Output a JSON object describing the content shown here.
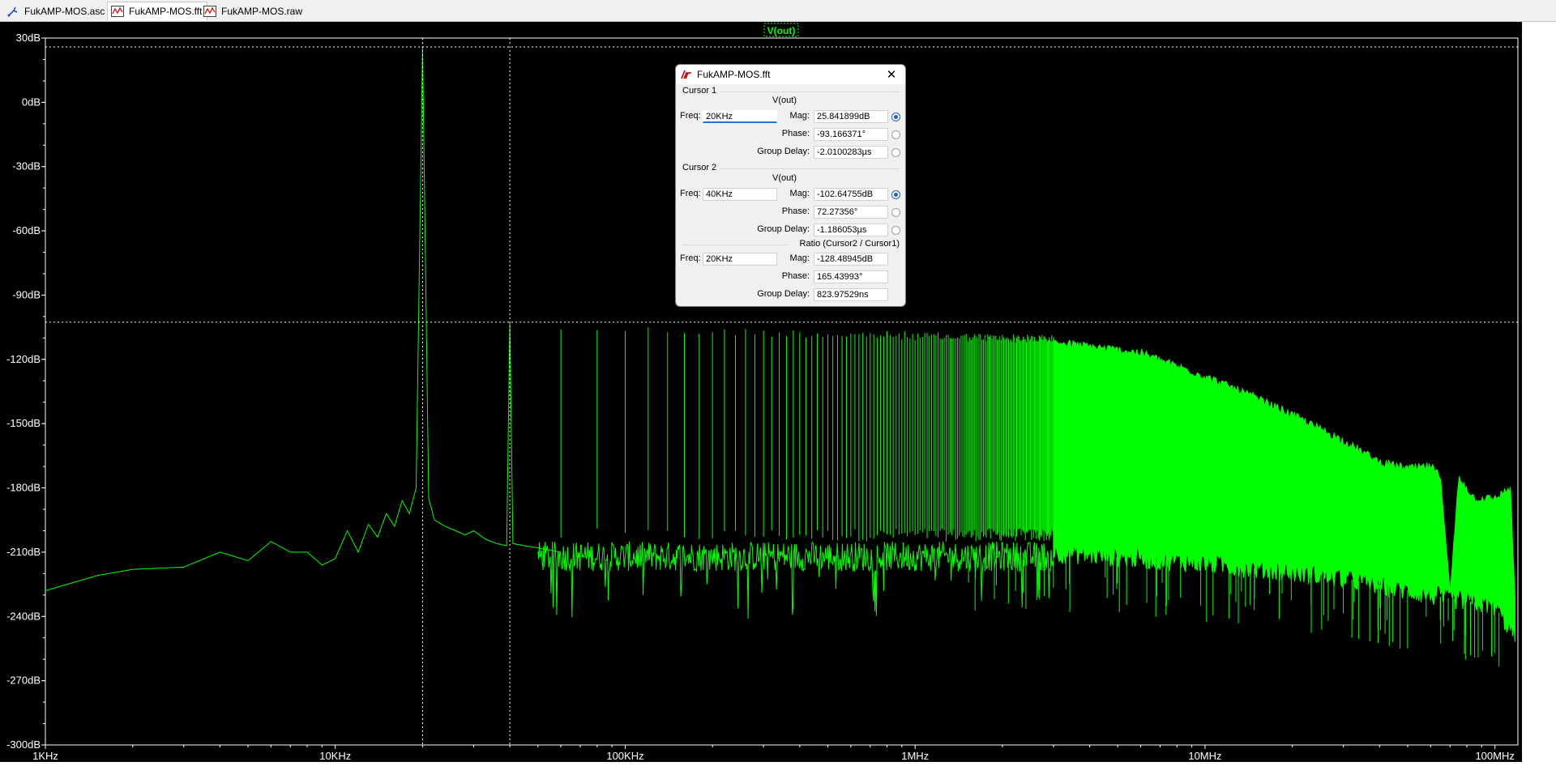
{
  "tabs": [
    {
      "label": "FukAMP-MOS.asc",
      "icon": "schematic-icon",
      "active": false
    },
    {
      "label": "FukAMP-MOS.fft",
      "icon": "waveform-icon",
      "active": true
    },
    {
      "label": "FukAMP-MOS.raw",
      "icon": "waveform-icon",
      "active": false
    }
  ],
  "trace_label": "V(out)",
  "colors": {
    "trace": "#00ff00",
    "background": "#000000",
    "axis": "#ffffff",
    "cursor": "#ffffff"
  },
  "chart_data": {
    "type": "line",
    "x_scale": "log",
    "xlim": [
      1000,
      120000000
    ],
    "ylim": [
      -300,
      30
    ],
    "x_ticks": [
      "1KHz",
      "10KHz",
      "100KHz",
      "1MHz",
      "10MHz",
      "100MHz"
    ],
    "x_tick_values": [
      1000,
      10000,
      100000,
      1000000,
      10000000,
      100000000
    ],
    "y_ticks": [
      "30dB",
      "0dB",
      "-30dB",
      "-60dB",
      "-90dB",
      "-120dB",
      "-150dB",
      "-180dB",
      "-210dB",
      "-240dB",
      "-270dB",
      "-300dB"
    ],
    "y_tick_values": [
      30,
      0,
      -30,
      -60,
      -90,
      -120,
      -150,
      -180,
      -210,
      -240,
      -270,
      -300
    ],
    "series": [
      {
        "name": "V(out)",
        "color": "#00ff00"
      }
    ],
    "floor_curve": [
      [
        1000,
        -228
      ],
      [
        1500,
        -221
      ],
      [
        2000,
        -218
      ],
      [
        3000,
        -217
      ],
      [
        4000,
        -210
      ],
      [
        5000,
        -214
      ],
      [
        6000,
        -205
      ],
      [
        7000,
        -210
      ],
      [
        8000,
        -210
      ],
      [
        9000,
        -216
      ],
      [
        10000,
        -213
      ],
      [
        11000,
        -200
      ],
      [
        12000,
        -210
      ],
      [
        13000,
        -197
      ],
      [
        14000,
        -203
      ],
      [
        15000,
        -192
      ],
      [
        16000,
        -198
      ],
      [
        17000,
        -186
      ],
      [
        18000,
        -192
      ],
      [
        19000,
        -180
      ],
      [
        20000,
        25.84
      ],
      [
        21000,
        -185
      ],
      [
        22000,
        -195
      ],
      [
        24000,
        -198
      ],
      [
        26000,
        -200
      ],
      [
        28000,
        -202
      ],
      [
        30000,
        -200
      ],
      [
        33000,
        -204
      ],
      [
        36000,
        -206
      ],
      [
        39000,
        -207
      ],
      [
        40000,
        -102.6
      ],
      [
        41000,
        -206
      ],
      [
        45000,
        -207
      ],
      [
        50000,
        -208
      ],
      [
        60000,
        -210
      ],
      [
        100000,
        -210
      ],
      [
        300000,
        -212
      ],
      [
        1000000,
        -212
      ],
      [
        3000000,
        -208
      ],
      [
        10000000,
        -205
      ],
      [
        30000000,
        -208
      ],
      [
        60000000,
        -215
      ],
      [
        70000000,
        -230
      ],
      [
        75000000,
        -175
      ],
      [
        85000000,
        -185
      ],
      [
        100000000,
        -185
      ],
      [
        113000000,
        -180
      ],
      [
        118000000,
        -240
      ]
    ],
    "envelope_top": [
      [
        3000000,
        -112
      ],
      [
        4000000,
        -114
      ],
      [
        6000000,
        -117
      ],
      [
        10000000,
        -128
      ],
      [
        15000000,
        -138
      ],
      [
        20000000,
        -146
      ],
      [
        30000000,
        -158
      ],
      [
        40000000,
        -168
      ],
      [
        50000000,
        -171
      ],
      [
        60000000,
        -170
      ],
      [
        65000000,
        -175
      ],
      [
        70000000,
        -230
      ],
      [
        75000000,
        -175
      ],
      [
        85000000,
        -185
      ],
      [
        100000000,
        -185
      ],
      [
        113000000,
        -180
      ],
      [
        118000000,
        -240
      ]
    ],
    "envelope_bottom": [
      [
        3000000,
        -210
      ],
      [
        10000000,
        -215
      ],
      [
        30000000,
        -222
      ],
      [
        60000000,
        -230
      ],
      [
        100000000,
        -235
      ],
      [
        118000000,
        -250
      ]
    ],
    "harmonics": {
      "fundamental": 20000,
      "count": 175,
      "peak_level": -102,
      "floor_level": -205
    },
    "cursor1": {
      "freq": 20000,
      "level": 25.841899
    },
    "cursor2": {
      "freq": 40000,
      "level": -102.64755
    }
  },
  "dialog": {
    "title": "FukAMP-MOS.fft",
    "cursor1": {
      "section": "Cursor 1",
      "trace": "V(out)",
      "freq_label": "Freq:",
      "freq": "20KHz",
      "mag_label": "Mag:",
      "mag": "25.841899dB",
      "phase_label": "Phase:",
      "phase": "-93.166371°",
      "gd_label": "Group Delay:",
      "gd": "-2.0100283µs"
    },
    "cursor2": {
      "section": "Cursor 2",
      "trace": "V(out)",
      "freq_label": "Freq:",
      "freq": "40KHz",
      "mag_label": "Mag:",
      "mag": "-102.64755dB",
      "phase_label": "Phase:",
      "phase": "72.27356°",
      "gd_label": "Group Delay:",
      "gd": "-1.186053µs"
    },
    "ratio": {
      "section": "Ratio (Cursor2 / Cursor1)",
      "freq_label": "Freq:",
      "freq": "20KHz",
      "mag_label": "Mag:",
      "mag": "-128.48945dB",
      "phase_label": "Phase:",
      "phase": "165.43993°",
      "gd_label": "Group Delay:",
      "gd": "823.97529ns"
    }
  }
}
